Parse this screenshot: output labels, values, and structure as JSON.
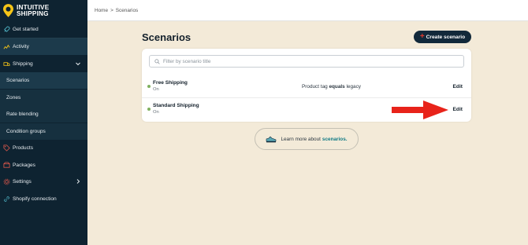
{
  "brand": {
    "line1": "INTUITIVE",
    "line2": "SHIPPING"
  },
  "breadcrumb": {
    "home": "Home",
    "separator": ">",
    "current": "Scenarios"
  },
  "sidebar": {
    "items": [
      {
        "label": "Get started",
        "icon": "rocket-icon"
      },
      {
        "label": "Activity",
        "icon": "activity-icon"
      },
      {
        "label": "Shipping",
        "icon": "truck-icon"
      },
      {
        "label": "Scenarios",
        "icon": ""
      },
      {
        "label": "Zones",
        "icon": ""
      },
      {
        "label": "Rate blending",
        "icon": ""
      },
      {
        "label": "Condition groups",
        "icon": ""
      },
      {
        "label": "Products",
        "icon": "tag-icon"
      },
      {
        "label": "Packages",
        "icon": "package-icon"
      },
      {
        "label": "Settings",
        "icon": "gear-icon"
      },
      {
        "label": "Shopify connection",
        "icon": "link-icon"
      }
    ]
  },
  "main": {
    "title": "Scenarios",
    "create_button": "Create scenario",
    "filter_placeholder": "Filter by scenario title",
    "scenarios": [
      {
        "title": "Free Shipping",
        "status": "On",
        "condition_pre": "Product tag",
        "condition_op": "equals",
        "condition_val": "legacy",
        "action": "Edit"
      },
      {
        "title": "Standard Shipping",
        "status": "On",
        "condition_pre": "",
        "condition_op": "",
        "condition_val": "",
        "action": "Edit"
      }
    ],
    "learn_more": {
      "text": "Learn more about",
      "link": "scenarios."
    }
  },
  "colors": {
    "sidebar_bg": "#0e2331",
    "page_bg": "#f3ead8",
    "accent_red": "#e03a2d",
    "status_green": "#7fb05f",
    "link_teal": "#0f7a85"
  }
}
